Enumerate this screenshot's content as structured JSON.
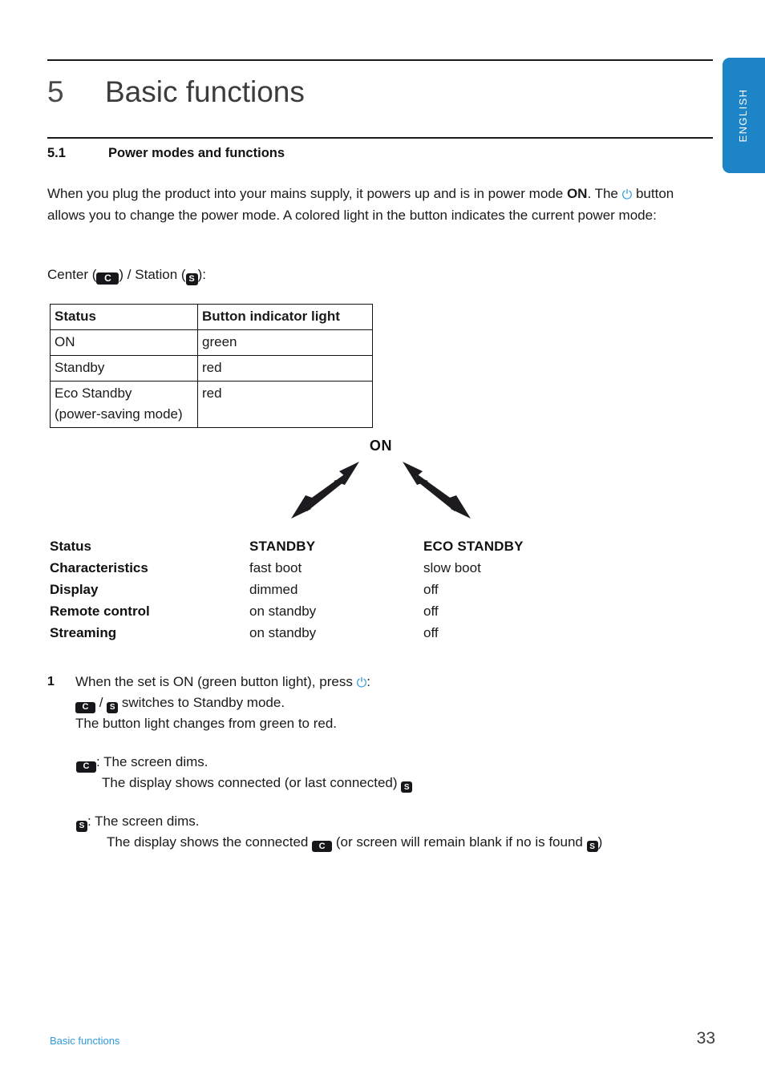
{
  "language_tab": {
    "label": "ENGLISH",
    "color": "#1e84c8"
  },
  "chapter": {
    "number": "5",
    "title": "Basic functions"
  },
  "section": {
    "number": "5.1",
    "title": "Power modes and functions"
  },
  "intro": {
    "part1": "When you plug the product into your mains supply, it powers up and is in power mode ",
    "bold_on": "ON",
    "part2": ". The ",
    "power_icon": "power-icon",
    "part3": " button allows you to change the power mode. A colored light in the button indicates the current power mode:"
  },
  "devices_line": {
    "center_label": "Center (",
    "center_icon": "C",
    "separator": ") / Station (",
    "station_icon": "S",
    "end": "):"
  },
  "status_table": {
    "headers": [
      "Status",
      "Button indicator light"
    ],
    "rows": [
      {
        "status": "ON",
        "light": "green"
      },
      {
        "status": "Standby",
        "light": "red"
      },
      {
        "status": "Eco Standby\n(power-saving mode)",
        "light": "red"
      }
    ]
  },
  "diagram": {
    "on_label": "ON",
    "arrows": [
      "double-arrow-left",
      "double-arrow-right"
    ]
  },
  "characteristics": {
    "rows": [
      {
        "label": "Status",
        "standby": "STANDBY",
        "eco": "ECO STANDBY",
        "head": true
      },
      {
        "label": "Characteristics",
        "standby": "fast boot",
        "eco": "slow boot"
      },
      {
        "label": "Display",
        "standby": "dimmed",
        "eco": "off"
      },
      {
        "label": "Remote control",
        "standby": "on standby",
        "eco": "off"
      },
      {
        "label": "Streaming",
        "standby": "on standby",
        "eco": "off"
      }
    ]
  },
  "step": {
    "number": "1",
    "line1_a": "When the set is ON (green button light), press ",
    "line1_b": ":",
    "line2_mid": " / ",
    "line2_end": " switches to Standby mode.",
    "line3": "The button light changes from green to red."
  },
  "sub_center": {
    "line1": ": The screen dims.",
    "line2": "The display shows connected (or last connected) "
  },
  "sub_station": {
    "line1": ":  The screen dims.",
    "line2_a": "The display shows the connected ",
    "line2_b": " (or screen will remain blank if no is found ",
    "line2_c": ")"
  },
  "footer": {
    "left": "Basic functions",
    "page": "33",
    "left_color": "#2e9ade"
  },
  "icons": {
    "center": "C",
    "station": "S",
    "power": "⏻"
  }
}
